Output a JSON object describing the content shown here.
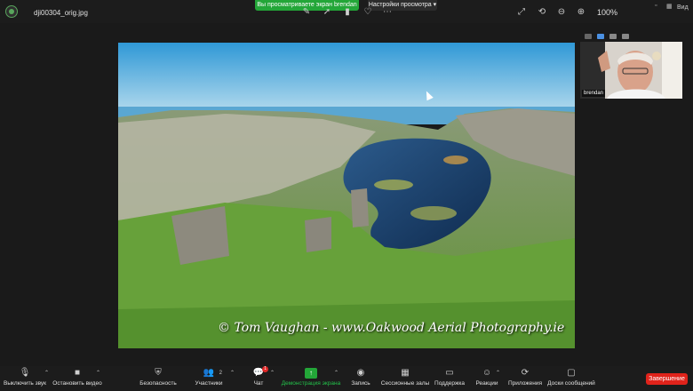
{
  "top": {
    "filename": "dji00304_orig.jpg",
    "share_banner": "Вы просматриваете экран brendan",
    "view_options": "Настройки просмотра ▾",
    "zoom": "100%",
    "view_label": "Вид"
  },
  "photo": {
    "credit": "© Tom Vaughan - www.Oakwood Aerial Photography.ie"
  },
  "participant": {
    "name": "brendan"
  },
  "toolbar": {
    "mute": "Выключить звук",
    "stop_video": "Остановить видео",
    "security": "Безопасность",
    "participants": "Участники",
    "participants_count": "2",
    "chat": "Чат",
    "chat_badge": "1",
    "share": "Демонстрация экрана",
    "record": "Запись",
    "breakout": "Сессионные залы",
    "support": "Поддержка",
    "reactions": "Реакции",
    "apps": "Приложения",
    "whiteboard": "Доски сообщений",
    "end": "Завершение"
  },
  "colors": {
    "accent_green": "#23a638",
    "end_red": "#e0231b"
  }
}
